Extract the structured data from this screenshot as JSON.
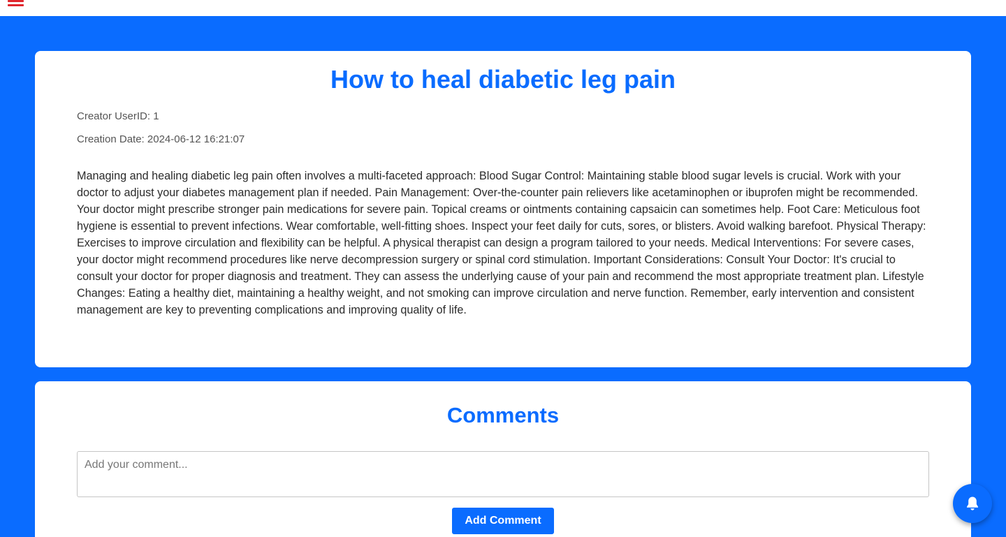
{
  "header": {
    "menu_icon": "hamburger-menu-icon"
  },
  "post": {
    "title": "How to heal diabetic leg pain",
    "creator": "Creator UserID: 1",
    "creation_date": "Creation Date: 2024-06-12 16:21:07",
    "body": "Managing and healing diabetic leg pain often involves a multi-faceted approach: Blood Sugar Control: Maintaining stable blood sugar levels is crucial. Work with your doctor to adjust your diabetes management plan if needed. Pain Management: Over-the-counter pain relievers like acetaminophen or ibuprofen might be recommended. Your doctor might prescribe stronger pain medications for severe pain. Topical creams or ointments containing capsaicin can sometimes help. Foot Care: Meticulous foot hygiene is essential to prevent infections. Wear comfortable, well-fitting shoes. Inspect your feet daily for cuts, sores, or blisters. Avoid walking barefoot. Physical Therapy: Exercises to improve circulation and flexibility can be helpful. A physical therapist can design a program tailored to your needs. Medical Interventions: For severe cases, your doctor might recommend procedures like nerve decompression surgery or spinal cord stimulation. Important Considerations: Consult Your Doctor: It's crucial to consult your doctor for proper diagnosis and treatment. They can assess the underlying cause of your pain and recommend the most appropriate treatment plan. Lifestyle Changes: Eating a healthy diet, maintaining a healthy weight, and not smoking can improve circulation and nerve function. Remember, early intervention and consistent management are key to preventing complications and improving quality of life."
  },
  "comments": {
    "title": "Comments",
    "input_placeholder": "Add your comment...",
    "input_value": "",
    "add_button_label": "Add Comment"
  },
  "notifications": {
    "icon": "bell-icon"
  },
  "colors": {
    "accent": "#0a6cff",
    "menu_icon": "#e0262d",
    "card_background": "#ffffff"
  }
}
